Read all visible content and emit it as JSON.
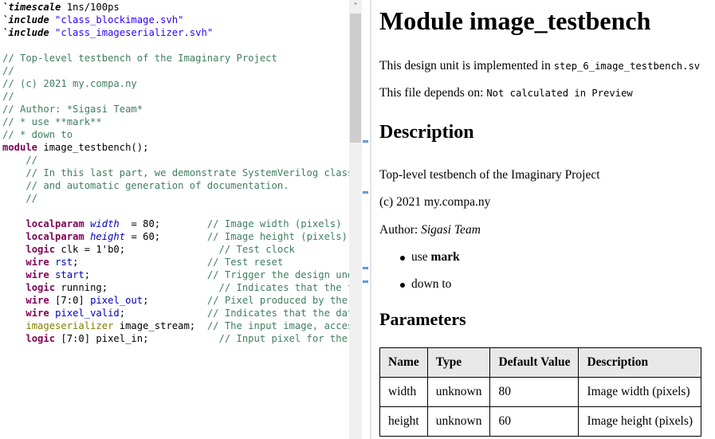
{
  "editor": {
    "lines": [
      [
        {
          "t": "`timescale",
          "c": "dir"
        },
        {
          "t": " 1ns/100ps",
          "c": "id"
        }
      ],
      [
        {
          "t": "`include",
          "c": "dir"
        },
        {
          "t": " ",
          "c": "id"
        },
        {
          "t": "\"class_blockimage.svh\"",
          "c": "str"
        }
      ],
      [
        {
          "t": "`include",
          "c": "dir"
        },
        {
          "t": " ",
          "c": "id"
        },
        {
          "t": "\"class_imageserializer.svh\"",
          "c": "str"
        }
      ],
      [],
      [
        {
          "t": "// Top-level testbench of the Imaginary Project",
          "c": "cm"
        }
      ],
      [
        {
          "t": "//",
          "c": "cm"
        }
      ],
      [
        {
          "t": "// (c) 2021 my.compa.ny",
          "c": "cm"
        }
      ],
      [
        {
          "t": "//",
          "c": "cm"
        }
      ],
      [
        {
          "t": "// Author: *Sigasi Team*",
          "c": "cm"
        }
      ],
      [
        {
          "t": "// * use **mark**",
          "c": "cm"
        }
      ],
      [
        {
          "t": "// * down to",
          "c": "cm"
        }
      ],
      [
        {
          "t": "module",
          "c": "kw"
        },
        {
          "t": " image_testbench();",
          "c": "id"
        }
      ],
      [
        {
          "t": "    //",
          "c": "cm"
        }
      ],
      [
        {
          "t": "    // In this last part, we demonstrate SystemVerilog classes",
          "c": "cm"
        }
      ],
      [
        {
          "t": "    // and automatic generation of documentation.",
          "c": "cm"
        }
      ],
      [
        {
          "t": "    //",
          "c": "cm"
        }
      ],
      [],
      [
        {
          "t": "    ",
          "c": "id"
        },
        {
          "t": "localparam",
          "c": "kw"
        },
        {
          "t": " ",
          "c": "id"
        },
        {
          "t": "width",
          "c": "par"
        },
        {
          "t": "  = 80;        ",
          "c": "id"
        },
        {
          "t": "// Image width (pixels)",
          "c": "cm"
        }
      ],
      [
        {
          "t": "    ",
          "c": "id"
        },
        {
          "t": "localparam",
          "c": "kw"
        },
        {
          "t": " ",
          "c": "id"
        },
        {
          "t": "height",
          "c": "par"
        },
        {
          "t": " = 60;        ",
          "c": "id"
        },
        {
          "t": "// Image height (pixels)",
          "c": "cm"
        }
      ],
      [
        {
          "t": "    ",
          "c": "id"
        },
        {
          "t": "logic",
          "c": "kw"
        },
        {
          "t": " clk = 1'b0;                ",
          "c": "id"
        },
        {
          "t": "// Test clock",
          "c": "cm"
        }
      ],
      [
        {
          "t": "    ",
          "c": "id"
        },
        {
          "t": "wire",
          "c": "kw"
        },
        {
          "t": " ",
          "c": "id"
        },
        {
          "t": "rst",
          "c": "sig"
        },
        {
          "t": ";                      ",
          "c": "id"
        },
        {
          "t": "// Test reset",
          "c": "cm"
        }
      ],
      [
        {
          "t": "    ",
          "c": "id"
        },
        {
          "t": "wire",
          "c": "kw"
        },
        {
          "t": " ",
          "c": "id"
        },
        {
          "t": "start",
          "c": "sig"
        },
        {
          "t": ";                    ",
          "c": "id"
        },
        {
          "t": "// Trigger the design under test",
          "c": "cm"
        }
      ],
      [
        {
          "t": "    ",
          "c": "id"
        },
        {
          "t": "logic",
          "c": "kw"
        },
        {
          "t": " running;                   ",
          "c": "id"
        },
        {
          "t": "// Indicates that the test",
          "c": "cm"
        }
      ],
      [
        {
          "t": "    ",
          "c": "id"
        },
        {
          "t": "wire",
          "c": "kw"
        },
        {
          "t": " [7:0] ",
          "c": "id"
        },
        {
          "t": "pixel_out",
          "c": "sig"
        },
        {
          "t": ";          ",
          "c": "id"
        },
        {
          "t": "// Pixel produced by the design",
          "c": "cm"
        }
      ],
      [
        {
          "t": "    ",
          "c": "id"
        },
        {
          "t": "wire",
          "c": "kw"
        },
        {
          "t": " ",
          "c": "id"
        },
        {
          "t": "pixel_valid",
          "c": "sig"
        },
        {
          "t": ";              ",
          "c": "id"
        },
        {
          "t": "// Indicates that the data",
          "c": "cm"
        }
      ],
      [
        {
          "t": "    ",
          "c": "id"
        },
        {
          "t": "imageserializer",
          "c": "cls"
        },
        {
          "t": " image_stream;  ",
          "c": "id"
        },
        {
          "t": "// The input image, accessed",
          "c": "cm"
        }
      ],
      [
        {
          "t": "    ",
          "c": "id"
        },
        {
          "t": "logic",
          "c": "kw"
        },
        {
          "t": " [7:0] pixel_in;            ",
          "c": "id"
        },
        {
          "t": "// Input pixel for the design",
          "c": "cm"
        }
      ]
    ],
    "scroll_up_glyph": "⌃"
  },
  "preview": {
    "title": "Module image_testbench",
    "impl_prefix": "This design unit is implemented in ",
    "impl_file": "step_6_image_testbench.sv",
    "dep_prefix": "This file depends on: ",
    "dep_value": "Not calculated in Preview",
    "description_heading": "Description",
    "desc_line1": "Top-level testbench of the Imaginary Project",
    "desc_line2": "(c) 2021 my.compa.ny",
    "author_prefix": "Author: ",
    "author_name": "Sigasi Team",
    "bullets": [
      {
        "prefix": "use ",
        "bold": "mark"
      },
      {
        "prefix": "down to",
        "bold": ""
      }
    ],
    "parameters_heading": "Parameters",
    "table": {
      "headers": [
        "Name",
        "Type",
        "Default Value",
        "Description"
      ],
      "rows": [
        [
          "width",
          "unknown",
          "80",
          "Image width (pixels)"
        ],
        [
          "height",
          "unknown",
          "60",
          "Image height (pixels)"
        ]
      ]
    }
  }
}
